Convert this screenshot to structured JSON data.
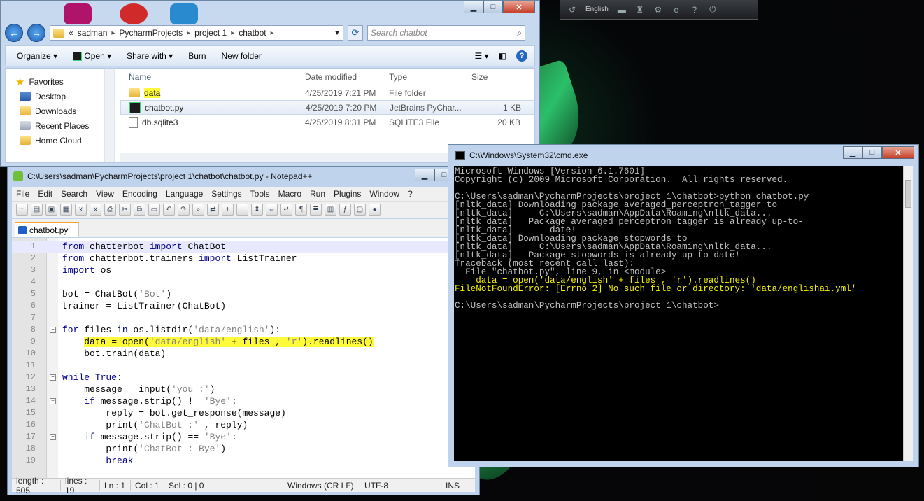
{
  "tray": {
    "language": "English"
  },
  "explorer": {
    "address": {
      "prefix": "«",
      "crumbs": [
        "sadman",
        "PycharmProjects",
        "project 1",
        "chatbot"
      ]
    },
    "search_placeholder": "Search chatbot",
    "toolbar": {
      "organize": "Organize",
      "open": "Open",
      "share_with": "Share with",
      "burn": "Burn",
      "new_folder": "New folder"
    },
    "nav": {
      "favorites": "Favorites",
      "items": [
        "Desktop",
        "Downloads",
        "Recent Places",
        "Home Cloud"
      ]
    },
    "columns": {
      "name": "Name",
      "date_modified": "Date modified",
      "type": "Type",
      "size": "Size"
    },
    "files": [
      {
        "name": "data",
        "date": "4/25/2019 7:21 PM",
        "type": "File folder",
        "size": ""
      },
      {
        "name": "chatbot.py",
        "date": "4/25/2019 7:20 PM",
        "type": "JetBrains PyChar...",
        "size": "1 KB"
      },
      {
        "name": "db.sqlite3",
        "date": "4/25/2019 8:31 PM",
        "type": "SQLITE3 File",
        "size": "20 KB"
      }
    ]
  },
  "npp": {
    "title": "C:\\Users\\sadman\\PycharmProjects\\project 1\\chatbot\\chatbot.py - Notepad++",
    "menu": [
      "File",
      "Edit",
      "Search",
      "View",
      "Encoding",
      "Language",
      "Settings",
      "Tools",
      "Macro",
      "Run",
      "Plugins",
      "Window",
      "?"
    ],
    "tab": "chatbot.py",
    "lines": [
      "from chatterbot import ChatBot",
      "from chatterbot.trainers import ListTrainer",
      "import os",
      "",
      "bot = ChatBot('Bot')",
      "trainer = ListTrainer(ChatBot)",
      "",
      "for files in os.listdir('data/english'):",
      "    data = open('data/english' + files , 'r').readlines()",
      "    bot.train(data)",
      "",
      "while True:",
      "    message = input('you :')",
      "    if message.strip() != 'Bye':",
      "        reply = bot.get_response(message)",
      "        print('ChatBot :' , reply)",
      "    if message.strip() == 'Bye':",
      "        print('ChatBot : Bye')",
      "        break"
    ],
    "status": {
      "length": "length : 505",
      "lines": "lines : 19",
      "ln": "Ln : 1",
      "col": "Col : 1",
      "sel": "Sel : 0 | 0",
      "eol": "Windows (CR LF)",
      "encoding": "UTF-8",
      "mode": "INS"
    }
  },
  "cmd": {
    "title": "C:\\Windows\\System32\\cmd.exe",
    "lines": [
      "Microsoft Windows [Version 6.1.7601]",
      "Copyright (c) 2009 Microsoft Corporation.  All rights reserved.",
      "",
      "C:\\Users\\sadman\\PycharmProjects\\project 1\\chatbot>python chatbot.py",
      "[nltk_data] Downloading package averaged_perceptron_tagger to",
      "[nltk_data]     C:\\Users\\sadman\\AppData\\Roaming\\nltk_data...",
      "[nltk_data]   Package averaged_perceptron_tagger is already up-to-",
      "[nltk_data]       date!",
      "[nltk_data] Downloading package stopwords to",
      "[nltk_data]     C:\\Users\\sadman\\AppData\\Roaming\\nltk_data...",
      "[nltk_data]   Package stopwords is already up-to-date!",
      "Traceback (most recent call last):",
      "  File \"chatbot.py\", line 9, in <module>",
      "    data = open('data/english' + files , 'r').readlines()",
      "FileNotFoundError: [Errno 2] No such file or directory: 'data/englishai.yml'",
      "",
      "C:\\Users\\sadman\\PycharmProjects\\project 1\\chatbot>"
    ],
    "highlight_color": "#f0f000"
  }
}
